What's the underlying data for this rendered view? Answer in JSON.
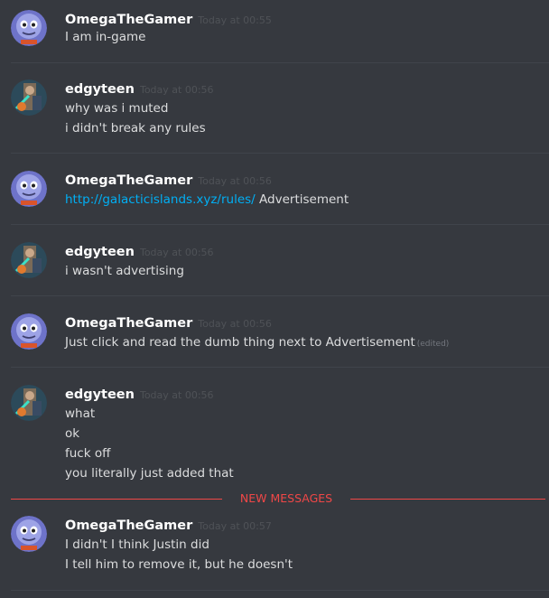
{
  "messages": [
    {
      "author": "OmegaTheGamer",
      "time": "Today at 00:55",
      "lines": [
        "I am in-game"
      ]
    },
    {
      "author": "edgyteen",
      "time": "Today at 00:56",
      "lines": [
        "why was i muted",
        "i didn't break any rules"
      ]
    },
    {
      "author": "OmegaTheGamer",
      "time": "Today at 00:56",
      "link": "http://galacticislands.xyz/rules/",
      "link_suffix": " Advertisement"
    },
    {
      "author": "edgyteen",
      "time": "Today at 00:56",
      "lines": [
        "i wasn't advertising"
      ]
    },
    {
      "author": "OmegaTheGamer",
      "time": "Today at 00:56",
      "lines": [
        "Just click and read the dumb thing next to Advertisement"
      ],
      "edited": "(edited)"
    },
    {
      "author": "edgyteen",
      "time": "Today at 00:56",
      "lines": [
        "what",
        "ok",
        "fuck off",
        "you literally just added that"
      ]
    },
    {
      "author": "OmegaTheGamer",
      "time": "Today at 00:57",
      "lines": [
        "I didn't I think Justin did",
        "I tell him to remove it, but he doesn't"
      ]
    }
  ],
  "new_messages_label": "NEW MESSAGES",
  "colors": {
    "background": "#36393f",
    "link": "#00aff4",
    "new_messages": "#f04747"
  }
}
